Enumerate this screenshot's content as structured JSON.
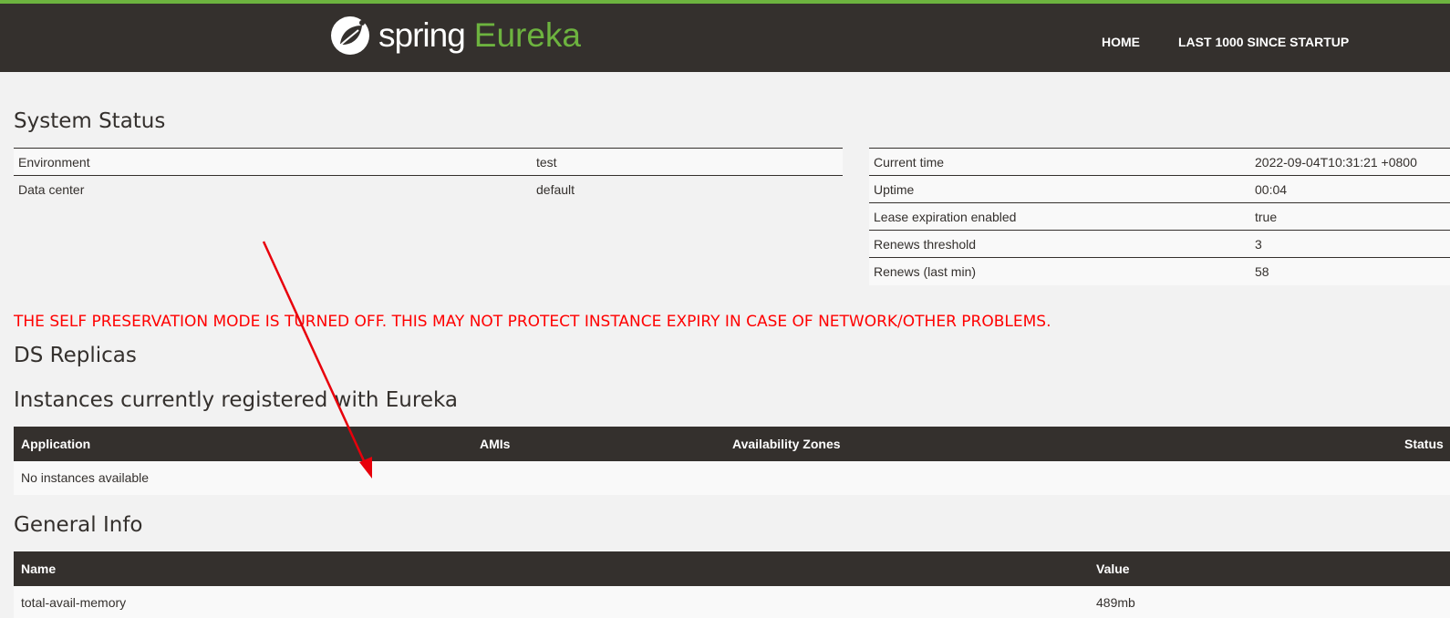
{
  "brand": {
    "spring": "spring",
    "eureka": "Eureka"
  },
  "nav": {
    "home": "HOME",
    "last": "LAST 1000 SINCE STARTUP"
  },
  "system_status": {
    "title": "System Status",
    "left": [
      {
        "label": "Environment",
        "value": "test"
      },
      {
        "label": "Data center",
        "value": "default"
      }
    ],
    "right": [
      {
        "label": "Current time",
        "value": "2022-09-04T10:31:21 +0800"
      },
      {
        "label": "Uptime",
        "value": "00:04"
      },
      {
        "label": "Lease expiration enabled",
        "value": "true"
      },
      {
        "label": "Renews threshold",
        "value": "3"
      },
      {
        "label": "Renews (last min)",
        "value": "58"
      }
    ]
  },
  "warning": "THE SELF PRESERVATION MODE IS TURNED OFF. THIS MAY NOT PROTECT INSTANCE EXPIRY IN CASE OF NETWORK/OTHER PROBLEMS.",
  "ds_replicas": {
    "title": "DS Replicas"
  },
  "instances": {
    "title": "Instances currently registered with Eureka",
    "headers": [
      "Application",
      "AMIs",
      "Availability Zones",
      "Status"
    ],
    "empty": "No instances available"
  },
  "general_info": {
    "title": "General Info",
    "headers": [
      "Name",
      "Value"
    ],
    "rows": [
      {
        "name": "total-avail-memory",
        "value": "489mb"
      }
    ]
  },
  "colors": {
    "header_bg": "#34302d",
    "accent": "#6db33f",
    "warning": "#ff0000"
  }
}
